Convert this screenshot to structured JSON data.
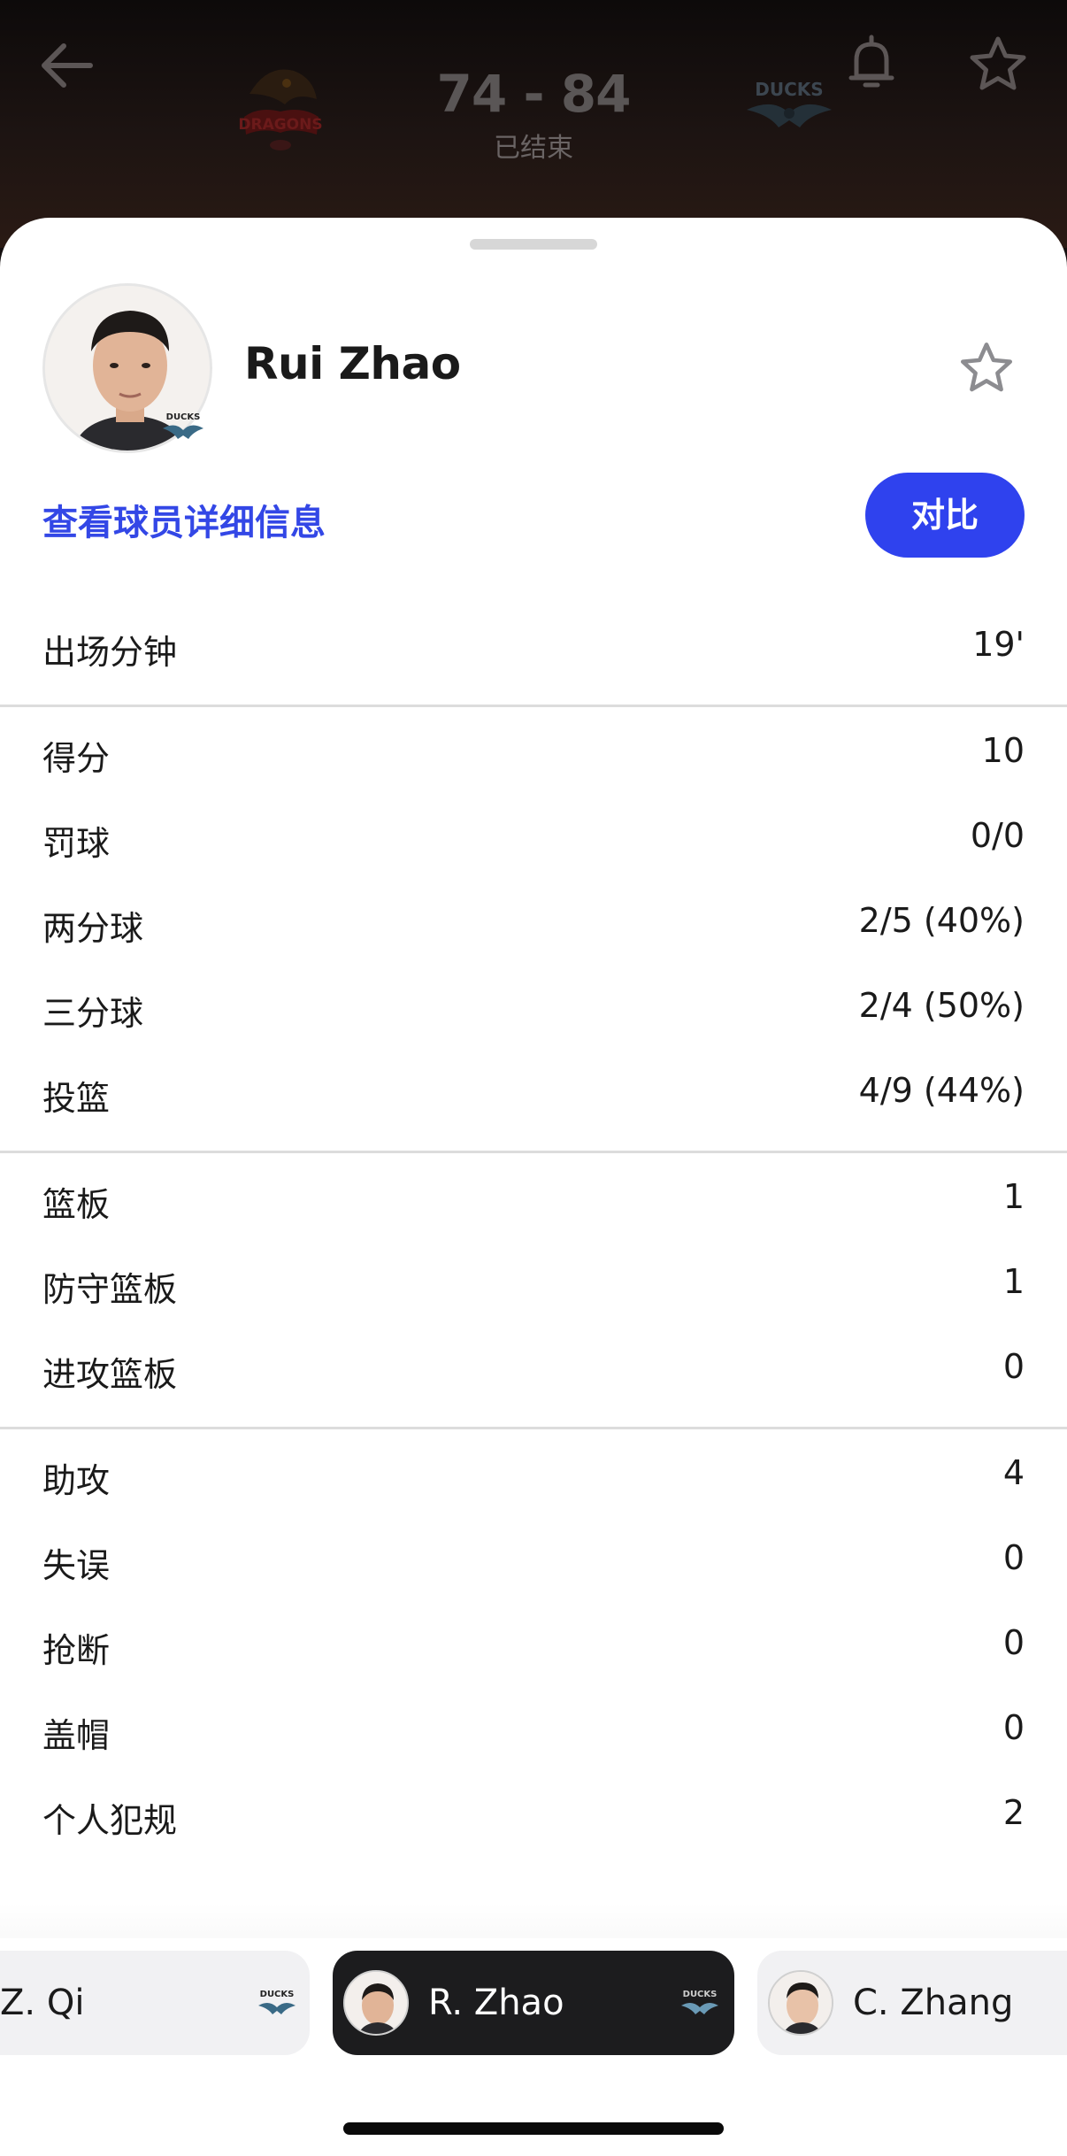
{
  "header": {
    "score": "74 - 84",
    "status": "已结束",
    "home_logo_text": "DRAGONS",
    "away_logo_text": "DUCKS"
  },
  "player": {
    "name": "Rui Zhao",
    "badge_text": "DUCKS",
    "details_link": "查看球员详细信息",
    "compare_label": "对比"
  },
  "stats": [
    {
      "label": "出场分钟",
      "value": "19'"
    },
    {
      "label": "得分",
      "value": "10"
    },
    {
      "label": "罚球",
      "value": "0/0"
    },
    {
      "label": "两分球",
      "value": "2/5 (40%)"
    },
    {
      "label": "三分球",
      "value": "2/4 (50%)"
    },
    {
      "label": "投篮",
      "value": "4/9 (44%)"
    },
    {
      "label": "篮板",
      "value": "1"
    },
    {
      "label": "防守篮板",
      "value": "1"
    },
    {
      "label": "进攻篮板",
      "value": "0"
    },
    {
      "label": "助攻",
      "value": "4"
    },
    {
      "label": "失误",
      "value": "0"
    },
    {
      "label": "抢断",
      "value": "0"
    },
    {
      "label": "盖帽",
      "value": "0"
    },
    {
      "label": "个人犯规",
      "value": "2"
    }
  ],
  "switcher": {
    "players": [
      {
        "name": "Z. Qi",
        "team": "DUCKS"
      },
      {
        "name": "R. Zhao",
        "team": "DUCKS"
      },
      {
        "name": "C. Zhang",
        "team": ""
      }
    ]
  },
  "colors": {
    "accent": "#2f42ee",
    "link": "#3347e6",
    "active_chip": "#1c1c1e"
  },
  "icons": {
    "back": "arrow-left-icon",
    "notify": "bell-icon",
    "favorite": "star-outline-icon"
  }
}
